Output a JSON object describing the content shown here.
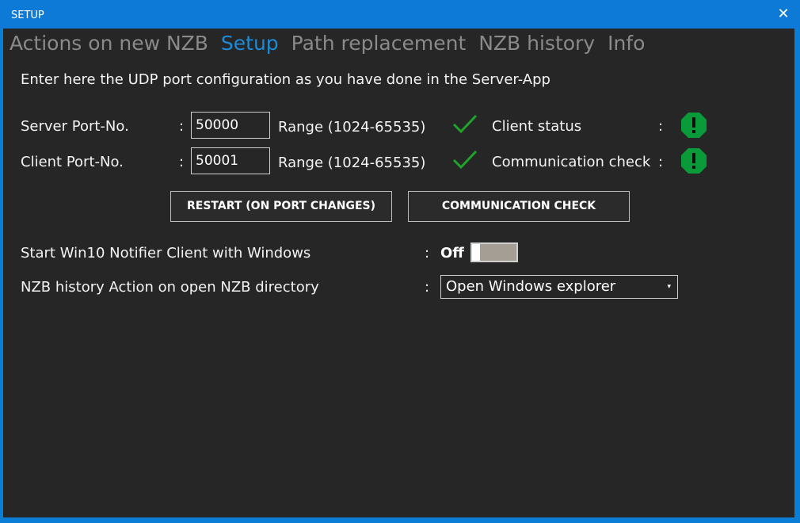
{
  "window": {
    "title": "SETUP",
    "close_glyph": "✕"
  },
  "tabs": [
    {
      "label": "Actions on new NZB",
      "active": false
    },
    {
      "label": "Setup",
      "active": true
    },
    {
      "label": "Path replacement",
      "active": false
    },
    {
      "label": "NZB history",
      "active": false
    },
    {
      "label": "Info",
      "active": false
    }
  ],
  "intro": "Enter here the UDP port configuration as you have done in the Server-App",
  "server_port": {
    "label": "Server Port-No.",
    "colon": ":",
    "value": "50000",
    "range": "Range (1024-65535)",
    "check_icon": "check-icon"
  },
  "client_port": {
    "label": "Client Port-No.",
    "colon": ":",
    "value": "50001",
    "range": "Range (1024-65535)",
    "check_icon": "check-icon"
  },
  "client_status": {
    "label": "Client status",
    "colon": ":",
    "icon": "warning-icon"
  },
  "communication_check": {
    "label": "Communication check",
    "colon": ":",
    "icon": "warning-icon"
  },
  "buttons": {
    "restart": "RESTART (ON PORT CHANGES)",
    "communication_check": "COMMUNICATION CHECK"
  },
  "start_with_windows": {
    "label": "Start Win10 Notifier Client with Windows",
    "colon": ":",
    "state": "Off"
  },
  "nzb_history_action": {
    "label": "NZB history Action on open NZB directory",
    "colon": ":",
    "selected": "Open Windows explorer",
    "arrow": "▾"
  },
  "colors": {
    "accent": "#1d8ad8",
    "background": "#262626",
    "check_green": "#1fa32b",
    "status_green": "#0b9a3a"
  }
}
